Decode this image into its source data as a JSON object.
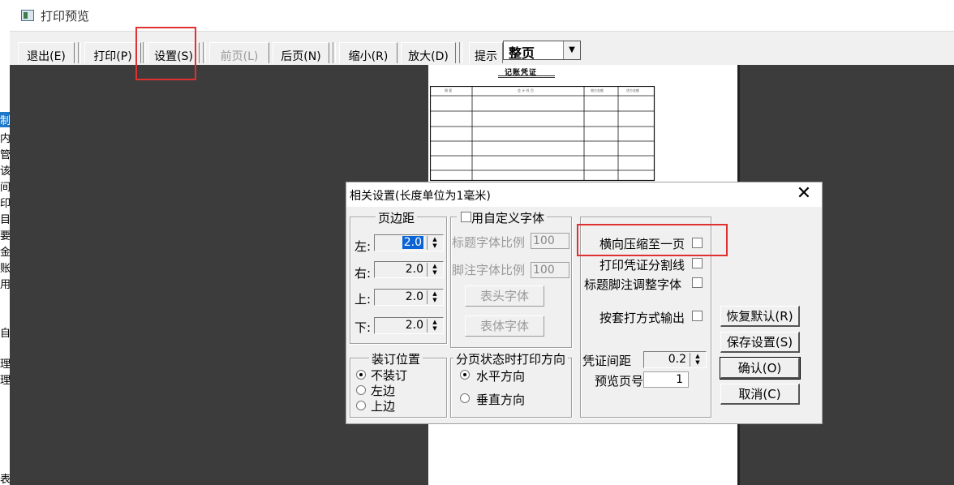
{
  "window": {
    "title": "打印预览"
  },
  "toolbar": {
    "buttons": [
      {
        "label": "退出(E)"
      },
      {
        "label": "打印(P)"
      },
      {
        "label": "设置(S)"
      },
      {
        "label": "前页(L)"
      },
      {
        "label": "后页(N)"
      },
      {
        "label": "缩小(R)"
      },
      {
        "label": "放大(D)"
      },
      {
        "label": "提示"
      }
    ],
    "zoom_value": "整页"
  },
  "left_strip": [
    "制",
    "内",
    "管",
    "该",
    "间",
    "印",
    "目",
    "要",
    "金",
    "账",
    "用",
    "",
    "自",
    "",
    "理",
    "理",
    "",
    "",
    "",
    "",
    "表"
  ],
  "paper": {
    "voucher_title": "记账凭证",
    "headers": [
      "摘 要",
      "会 计 科 目",
      "借方金额",
      "贷方金额"
    ]
  },
  "dialog": {
    "title": "相关设置(长度单位为1毫米)",
    "margins": {
      "title": "页边距",
      "left_label": "左:",
      "left_value": "2.0",
      "right_label": "右:",
      "right_value": "2.0",
      "top_label": "上:",
      "top_value": "2.0",
      "bottom_label": "下:",
      "bottom_value": "2.0"
    },
    "custom_font": {
      "title": "用自定义字体",
      "title_scale_label": "标题字体比例",
      "title_scale_value": "100",
      "footer_scale_label": "脚注字体比例",
      "footer_scale_value": "100",
      "header_font_btn": "表头字体",
      "body_font_btn": "表体字体"
    },
    "binding": {
      "title": "装订位置",
      "options": [
        "不装订",
        "左边",
        "上边"
      ]
    },
    "print_direction": {
      "title": "分页状态时打印方向",
      "options": [
        "水平方向",
        "垂直方向"
      ]
    },
    "options": {
      "compress_label": "横向压缩至一页",
      "split_line_label": "打印凭证分割线",
      "adjust_font_label": "标题脚注调整字体",
      "overlay_label": "按套打方式输出",
      "spacing_label": "凭证间距",
      "spacing_value": "0.2",
      "preview_page_label": "预览页号",
      "preview_page_value": "1"
    },
    "buttons": {
      "restore": "恢复默认(R)",
      "save": "保存设置(S)",
      "ok": "确认(O)",
      "cancel": "取消(C)"
    }
  },
  "colors": {
    "highlight": "#e03030",
    "preview_bg": "#3c3c3c",
    "selection": "#0a64d6"
  }
}
